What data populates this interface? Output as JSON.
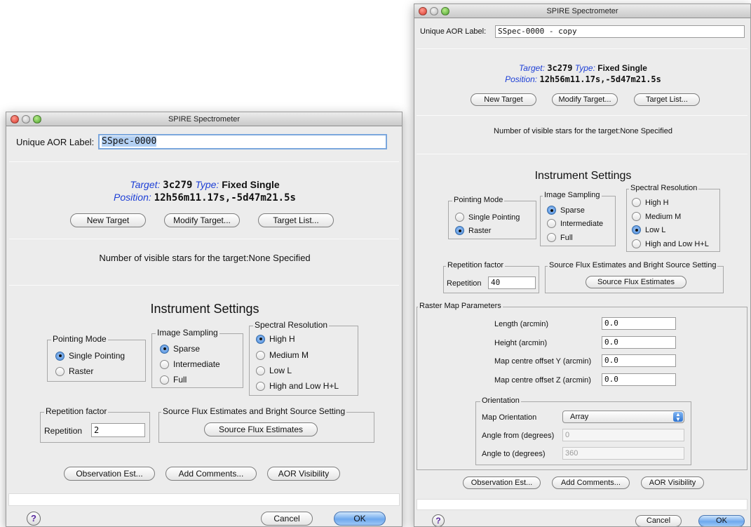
{
  "left_window": {
    "title": "SPIRE Spectrometer",
    "aor_label_caption": "Unique AOR Label:",
    "aor_label_value": "SSpec-0000",
    "target_caption": "Target:",
    "target_value": "3c279",
    "type_caption": "Type:",
    "type_value": "Fixed Single",
    "position_caption": "Position:",
    "position_value": "12h56m11.17s,-5d47m21.5s",
    "new_target": "New Target",
    "modify_target": "Modify Target...",
    "target_list": "Target List...",
    "visible_stars": "Number of visible stars for the target:None Specified",
    "instrument_settings": "Instrument Settings",
    "pointing_mode": "Pointing Mode",
    "pointing_options": [
      "Single Pointing",
      "Raster"
    ],
    "pointing_selected": "Single Pointing",
    "image_sampling": "Image Sampling",
    "sampling_options": [
      "Sparse",
      "Intermediate",
      "Full"
    ],
    "sampling_selected": "Sparse",
    "spectral_resolution": "Spectral Resolution",
    "spectral_options": [
      "High H",
      "Medium M",
      "Low L",
      "High and Low H+L"
    ],
    "spectral_selected": "High H",
    "repetition_factor": "Repetition factor",
    "repetition_caption": "Repetition",
    "repetition_value": "2",
    "flux_group": "Source Flux Estimates and Bright Source Setting",
    "flux_button": "Source Flux Estimates",
    "observation_est": "Observation Est...",
    "add_comments": "Add Comments...",
    "aor_visibility": "AOR Visibility",
    "help": "?",
    "cancel": "Cancel",
    "ok": "OK"
  },
  "right_window": {
    "title": "SPIRE Spectrometer",
    "aor_label_caption": "Unique AOR Label:",
    "aor_label_value": "SSpec-0000 - copy",
    "target_caption": "Target:",
    "target_value": "3c279",
    "type_caption": "Type:",
    "type_value": "Fixed Single",
    "position_caption": "Position:",
    "position_value": "12h56m11.17s,-5d47m21.5s",
    "new_target": "New Target",
    "modify_target": "Modify Target...",
    "target_list": "Target List...",
    "visible_stars": "Number of visible stars for the target:None Specified",
    "instrument_settings": "Instrument Settings",
    "pointing_mode": "Pointing Mode",
    "pointing_options": [
      "Single Pointing",
      "Raster"
    ],
    "pointing_selected": "Raster",
    "image_sampling": "Image Sampling",
    "sampling_options": [
      "Sparse",
      "Intermediate",
      "Full"
    ],
    "sampling_selected": "Sparse",
    "spectral_resolution": "Spectral Resolution",
    "spectral_options": [
      "High H",
      "Medium M",
      "Low L",
      "High and Low H+L"
    ],
    "spectral_selected": "Low L",
    "repetition_factor": "Repetition factor",
    "repetition_caption": "Repetition",
    "repetition_value": "40",
    "flux_group": "Source Flux Estimates and Bright Source Setting",
    "flux_button": "Source Flux Estimates",
    "raster_group": "Raster Map Parameters",
    "raster_fields": [
      {
        "label": "Length (arcmin)",
        "value": "0.0"
      },
      {
        "label": "Height (arcmin)",
        "value": "0.0"
      },
      {
        "label": "Map centre offset Y (arcmin)",
        "value": "0.0"
      },
      {
        "label": "Map centre offset Z (arcmin)",
        "value": "0.0"
      }
    ],
    "orientation_group": "Orientation",
    "map_orientation_caption": "Map Orientation",
    "map_orientation_value": "Array",
    "angle_from_caption": "Angle from (degrees)",
    "angle_from_value": "0",
    "angle_to_caption": "Angle to (degrees)",
    "angle_to_value": "360",
    "observation_est": "Observation Est...",
    "add_comments": "Add Comments...",
    "aor_visibility": "AOR Visibility",
    "help": "?",
    "cancel": "Cancel",
    "ok": "OK"
  }
}
